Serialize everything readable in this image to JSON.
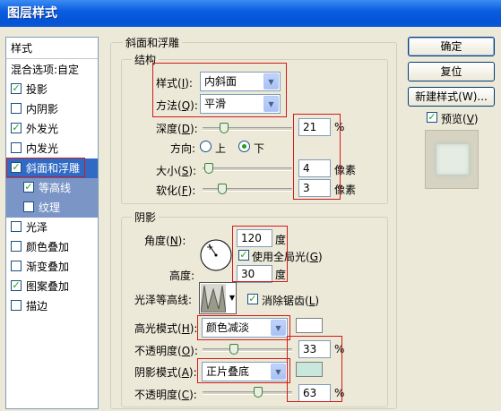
{
  "window": {
    "title": "图层样式"
  },
  "style_list": {
    "header": "样式",
    "blending_options": "混合选项:自定",
    "items": [
      {
        "label": "投影",
        "checked": true
      },
      {
        "label": "内阴影",
        "checked": false
      },
      {
        "label": "外发光",
        "checked": true
      },
      {
        "label": "内发光",
        "checked": false
      },
      {
        "label": "斜面和浮雕",
        "checked": true,
        "selected": true
      },
      {
        "label": "等高线",
        "checked": true,
        "sub": true
      },
      {
        "label": "纹理",
        "checked": false,
        "sub": true
      },
      {
        "label": "光泽",
        "checked": false
      },
      {
        "label": "颜色叠加",
        "checked": false
      },
      {
        "label": "渐变叠加",
        "checked": false
      },
      {
        "label": "图案叠加",
        "checked": true
      },
      {
        "label": "描边",
        "checked": false
      }
    ]
  },
  "bevel": {
    "section_title": "斜面和浮雕",
    "structure_title": "结构",
    "style_label": "样式(",
    "style_key": "I",
    "style_value": "内斜面",
    "technique_label": "方法(",
    "technique_key": "Q",
    "technique_value": "平滑",
    "depth_label": "深度(",
    "depth_key": "D",
    "depth_value": "21",
    "depth_unit": "%",
    "depth_level": 0.21,
    "direction_label": "方向:",
    "direction_up": "上",
    "direction_down": "下",
    "direction_selected": "下",
    "size_label": "大小(",
    "size_key": "S",
    "size_value": "4",
    "size_unit": "像素",
    "size_level": 0.02,
    "soften_label": "软化(",
    "soften_key": "F",
    "soften_value": "3",
    "soften_unit": "像素",
    "soften_level": 0.19
  },
  "shading": {
    "title": "阴影",
    "angle_label": "角度(",
    "angle_key": "N",
    "angle_value": "120",
    "angle_unit": "度",
    "global_light_label": "使用全局光(",
    "global_light_key": "G",
    "global_light_checked": true,
    "altitude_label": "高度:",
    "altitude_value": "30",
    "altitude_unit": "度",
    "gloss_contour_label": "光泽等高线:",
    "anti_alias_label": "消除锯齿(",
    "anti_alias_key": "L",
    "anti_alias_checked": true,
    "highlight_mode_label": "高光模式(",
    "highlight_mode_key": "H",
    "highlight_mode_value": "颜色减淡",
    "highlight_color": "#ffffff",
    "highlight_opacity_label": "不透明度(",
    "highlight_opacity_key": "O",
    "highlight_opacity_value": "33",
    "highlight_opacity_unit": "%",
    "highlight_opacity_level": 0.33,
    "shadow_mode_label": "阴影模式(",
    "shadow_mode_key": "A",
    "shadow_mode_value": "正片叠底",
    "shadow_color": "#c8e8de",
    "shadow_opacity_label": "不透明度(",
    "shadow_opacity_key": "C",
    "shadow_opacity_value": "63",
    "shadow_opacity_unit": "%",
    "shadow_opacity_level": 0.63
  },
  "buttons": {
    "ok": "确定",
    "reset": "复位",
    "new_style": "新建样式(W)...",
    "preview_label": "预览(",
    "preview_key": "V",
    "preview_checked": true
  },
  "colors": {
    "title_bar": "#0553d6",
    "selection": "#316ac5",
    "highlight_box": "#d21a1a"
  }
}
